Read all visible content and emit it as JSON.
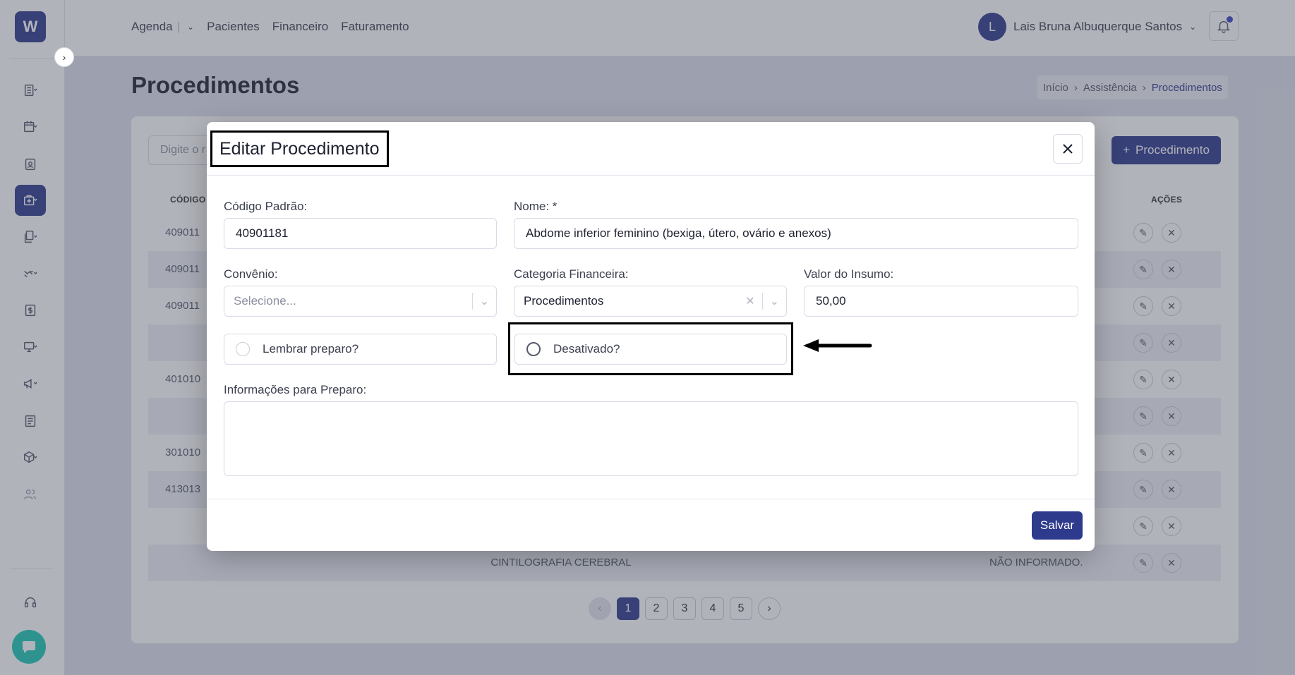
{
  "app": {
    "logo_letter": "W"
  },
  "topnav": {
    "items": [
      "Agenda",
      "Pacientes",
      "Financeiro",
      "Faturamento"
    ]
  },
  "user": {
    "initial": "L",
    "name": "Lais Bruna Albuquerque Santos"
  },
  "page": {
    "title": "Procedimentos"
  },
  "breadcrumb": {
    "items": [
      "Início",
      "Assistência",
      "Procedimentos"
    ]
  },
  "list": {
    "search_placeholder": "Digite o r",
    "add_button": "Procedimento",
    "col_code": "CÓDIGO",
    "col_actions": "AÇÕES",
    "rows": [
      {
        "code": "409011",
        "desc": "",
        "conv": ""
      },
      {
        "code": "409011",
        "desc": "",
        "conv": ""
      },
      {
        "code": "409011",
        "desc": "",
        "conv": ""
      },
      {
        "code": "",
        "desc": "",
        "conv": ""
      },
      {
        "code": "401010",
        "desc": "",
        "conv": ""
      },
      {
        "code": "",
        "desc": "",
        "conv": ""
      },
      {
        "code": "301010",
        "desc": "",
        "conv": ""
      },
      {
        "code": "413013",
        "desc": "",
        "conv": ""
      },
      {
        "code": "",
        "desc": "",
        "conv": ""
      },
      {
        "code": "",
        "desc": "CINTILOGRAFIA CEREBRAL",
        "conv": "NÃO INFORMADO."
      }
    ],
    "pages": [
      "1",
      "2",
      "3",
      "4",
      "5"
    ]
  },
  "modal": {
    "title": "Editar Procedimento",
    "codigo_label": "Código Padrão:",
    "codigo_value": "40901181",
    "nome_label": "Nome: *",
    "nome_value": "Abdome inferior feminino (bexiga, útero, ovário e anexos)",
    "convenio_label": "Convênio:",
    "convenio_placeholder": "Selecione...",
    "categoria_label": "Categoria Financeira:",
    "categoria_value": "Procedimentos",
    "valor_label": "Valor do Insumo:",
    "valor_value": "50,00",
    "lembrar_label": "Lembrar preparo?",
    "desativado_label": "Desativado?",
    "info_label": "Informações para Preparo:",
    "info_value": "",
    "save_label": "Salvar"
  }
}
